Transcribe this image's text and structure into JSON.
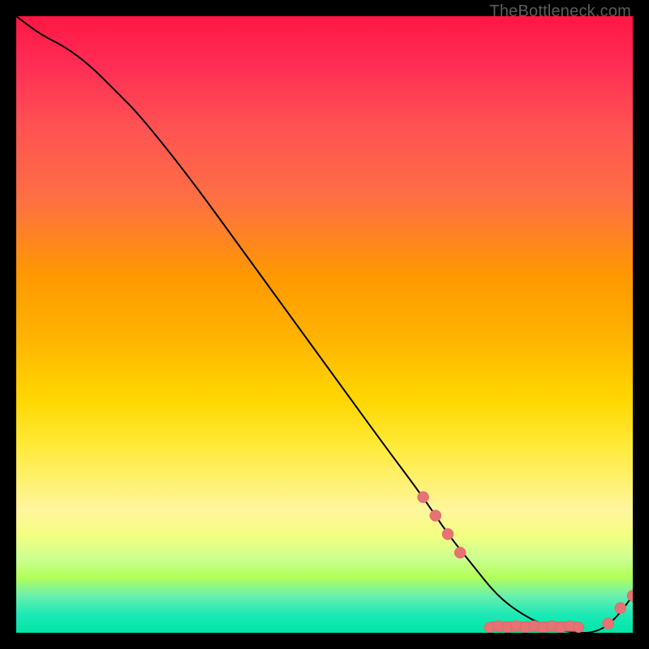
{
  "watermark": "TheBottleneck.com",
  "colors": {
    "curve": "#000000",
    "dot": "#e57373",
    "bg_top": "#ff1744",
    "bg_bottom": "#00e5a8",
    "frame": "#000000"
  },
  "chart_data": {
    "type": "line",
    "title": "",
    "xlabel": "",
    "ylabel": "",
    "xlim": [
      0,
      100
    ],
    "ylim": [
      0,
      100
    ],
    "series": [
      {
        "name": "bottleneck-curve",
        "x": [
          0,
          4,
          8,
          12,
          16,
          20,
          28,
          36,
          44,
          52,
          60,
          66,
          70,
          74,
          78,
          82,
          86,
          90,
          94,
          97,
          100
        ],
        "y": [
          100,
          97,
          95,
          92,
          88,
          84,
          74,
          63,
          52,
          41,
          30,
          22,
          16,
          11,
          6,
          3,
          1,
          0,
          0,
          2,
          6
        ]
      }
    ],
    "markers": [
      {
        "name": "cluster-decline-1",
        "x": 66,
        "y": 22
      },
      {
        "name": "cluster-decline-2",
        "x": 68,
        "y": 19
      },
      {
        "name": "cluster-decline-3",
        "x": 70,
        "y": 16
      },
      {
        "name": "cluster-decline-4",
        "x": 72,
        "y": 13
      },
      {
        "name": "flat-strip-center",
        "x": 84,
        "y": 1
      },
      {
        "name": "tail-1",
        "x": 96,
        "y": 1.5
      },
      {
        "name": "tail-2",
        "x": 98,
        "y": 4
      },
      {
        "name": "tail-3",
        "x": 100,
        "y": 6
      }
    ],
    "annotations": []
  }
}
